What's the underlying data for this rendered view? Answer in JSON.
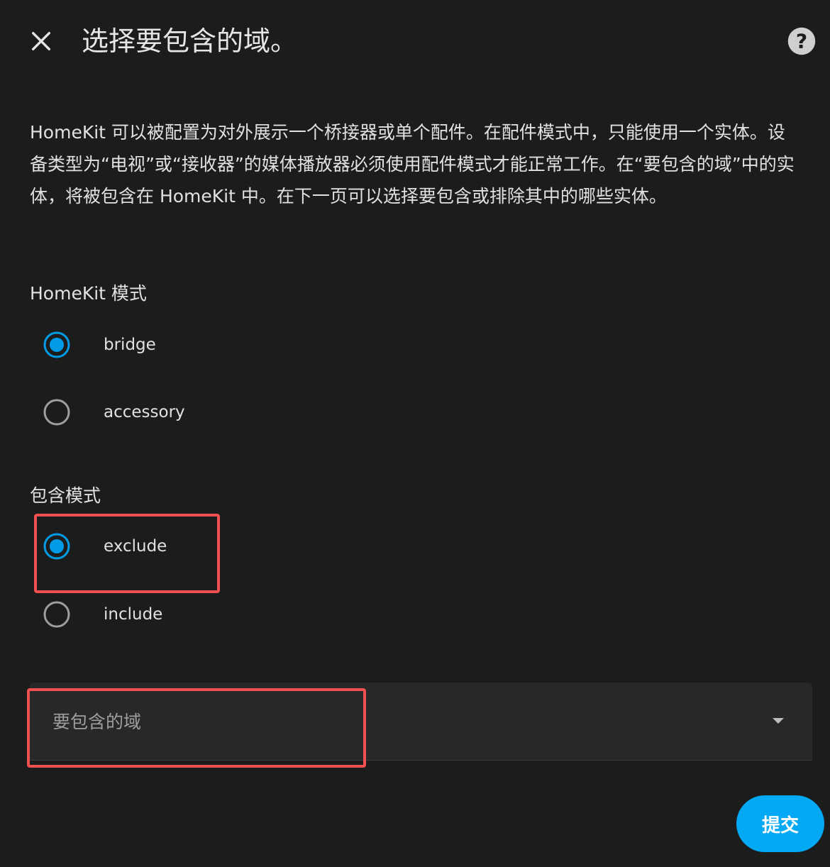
{
  "header": {
    "title": "选择要包含的域。",
    "close_icon": "close-icon",
    "help_icon": "help-icon"
  },
  "description": "HomeKit 可以被配置为对外展示一个桥接器或单个配件。在配件模式中，只能使用一个实体。设备类型为“电视”或“接收器”的媒体播放器必须使用配件模式才能正常工作。在“要包含的域”中的实体，将被包含在 HomeKit 中。在下一页可以选择要包含或排除其中的哪些实体。",
  "homekit_mode": {
    "label": "HomeKit 模式",
    "options": [
      {
        "label": "bridge",
        "selected": true
      },
      {
        "label": "accessory",
        "selected": false
      }
    ]
  },
  "include_mode": {
    "label": "包含模式",
    "options": [
      {
        "label": "exclude",
        "selected": true
      },
      {
        "label": "include",
        "selected": false
      }
    ]
  },
  "domains_select": {
    "placeholder": "要包含的域"
  },
  "submit": {
    "label": "提交"
  },
  "colors": {
    "background": "#1c1c1c",
    "accent": "#03a9f4",
    "radio_selected": "#039be5",
    "radio_unselected": "#9e9e9e",
    "highlight": "#f05050"
  }
}
